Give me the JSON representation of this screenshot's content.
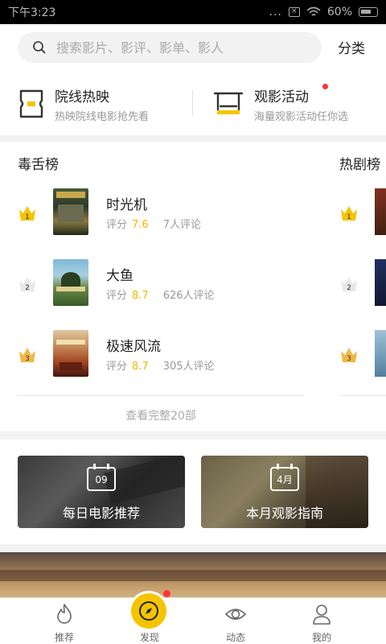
{
  "status_bar": {
    "time": "下午3:23",
    "dots": "...",
    "battery": "60%"
  },
  "search": {
    "placeholder": "搜索影片、影评、影单、影人",
    "category_label": "分类"
  },
  "entries": [
    {
      "title": "院线热映",
      "subtitle": "热映院线电影抢先看"
    },
    {
      "title": "观影活动",
      "subtitle": "海量观影活动任你选"
    }
  ],
  "rankings": {
    "left_title": "毒舌榜",
    "right_title": "热剧榜",
    "score_label": "评分",
    "items": [
      {
        "rank": "1",
        "name": "时光机",
        "score": "7.6",
        "reviews": "7人评论"
      },
      {
        "rank": "2",
        "name": "大鱼",
        "score": "8.7",
        "reviews": "626人评论"
      },
      {
        "rank": "3",
        "name": "极速风流",
        "score": "8.7",
        "reviews": "305人评论"
      }
    ],
    "view_all": "查看完整20部"
  },
  "promos": [
    {
      "calendar": "09",
      "label": "每日电影推荐"
    },
    {
      "calendar": "4月",
      "label": "本月观影指南"
    }
  ],
  "tabs": [
    {
      "label": "推荐",
      "icon": "flame-icon"
    },
    {
      "label": "发现",
      "icon": "compass-icon"
    },
    {
      "label": "动态",
      "icon": "eye-icon"
    },
    {
      "label": "我的",
      "icon": "user-icon"
    }
  ],
  "colors": {
    "accent": "#f5c400",
    "score": "#f5b800",
    "badge": "#ff3333"
  }
}
